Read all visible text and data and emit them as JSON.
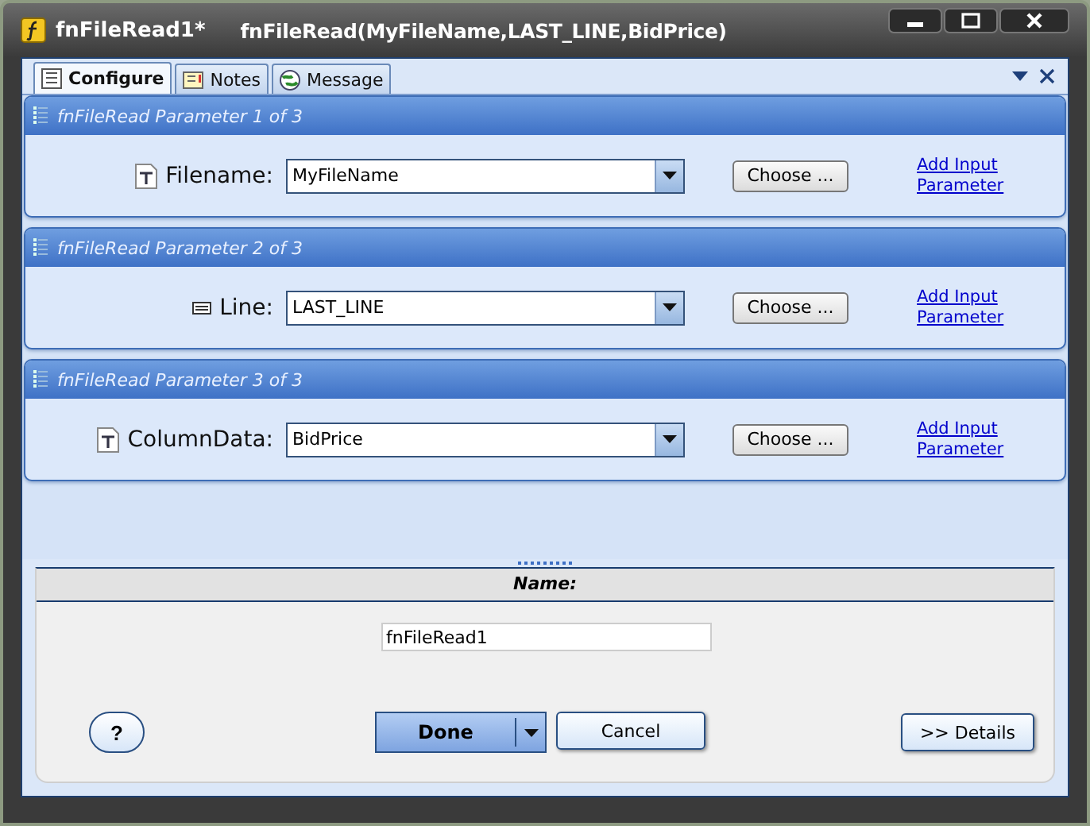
{
  "window": {
    "title": "fnFileRead1*",
    "subtitle": "fnFileRead(MyFileName,LAST_LINE,BidPrice)"
  },
  "tabs": [
    {
      "label": "Configure",
      "selected": true
    },
    {
      "label": "Notes",
      "selected": false
    },
    {
      "label": "Message",
      "selected": false
    }
  ],
  "parameters": [
    {
      "title": "fnFileRead Parameter 1 of 3",
      "kind": "text",
      "label": "Filename:",
      "value": "MyFileName",
      "choose": "Choose ...",
      "link": "Add Input Parameter"
    },
    {
      "title": "fnFileRead Parameter 2 of 3",
      "kind": "line",
      "label": "Line:",
      "value": "LAST_LINE",
      "choose": "Choose ...",
      "link": "Add Input Parameter"
    },
    {
      "title": "fnFileRead Parameter 3 of 3",
      "kind": "text",
      "label": "ColumnData:",
      "value": "BidPrice",
      "choose": "Choose ...",
      "link": "Add Input Parameter"
    }
  ],
  "name_section": {
    "heading": "Name:",
    "value": "fnFileRead1"
  },
  "buttons": {
    "help": "?",
    "done": "Done",
    "cancel": "Cancel",
    "details": ">> Details"
  }
}
